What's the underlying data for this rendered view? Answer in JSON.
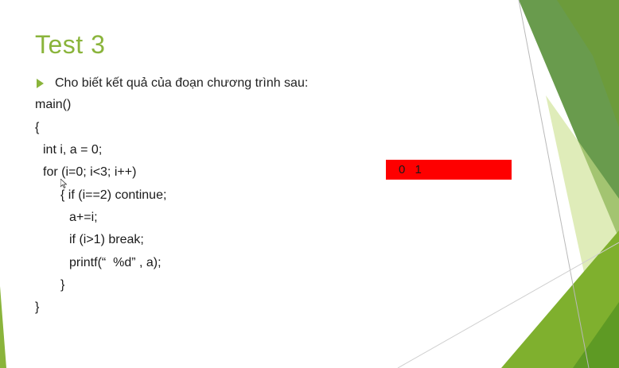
{
  "slide": {
    "title": "Test 3",
    "bullet_text": "Cho biết kết quả của đoạn chương trình sau:",
    "code_lines": [
      "main()",
      "{",
      "int i, a = 0;",
      "for (i=0; i<3; i++)",
      "{ if (i==2) continue;",
      "a+=i;",
      "if (i>1) break;",
      "printf(“  %d” , a);",
      "}",
      "}"
    ],
    "answer": "0  1"
  },
  "colors": {
    "accent_green": "#8ab43b",
    "dark_green": "#4f8a2e",
    "light_green": "#c9df8a",
    "answer_box": "#fe0000"
  },
  "icons": {
    "bullet": "triangle-bullet-icon",
    "cursor": "mouse-pointer-icon"
  }
}
